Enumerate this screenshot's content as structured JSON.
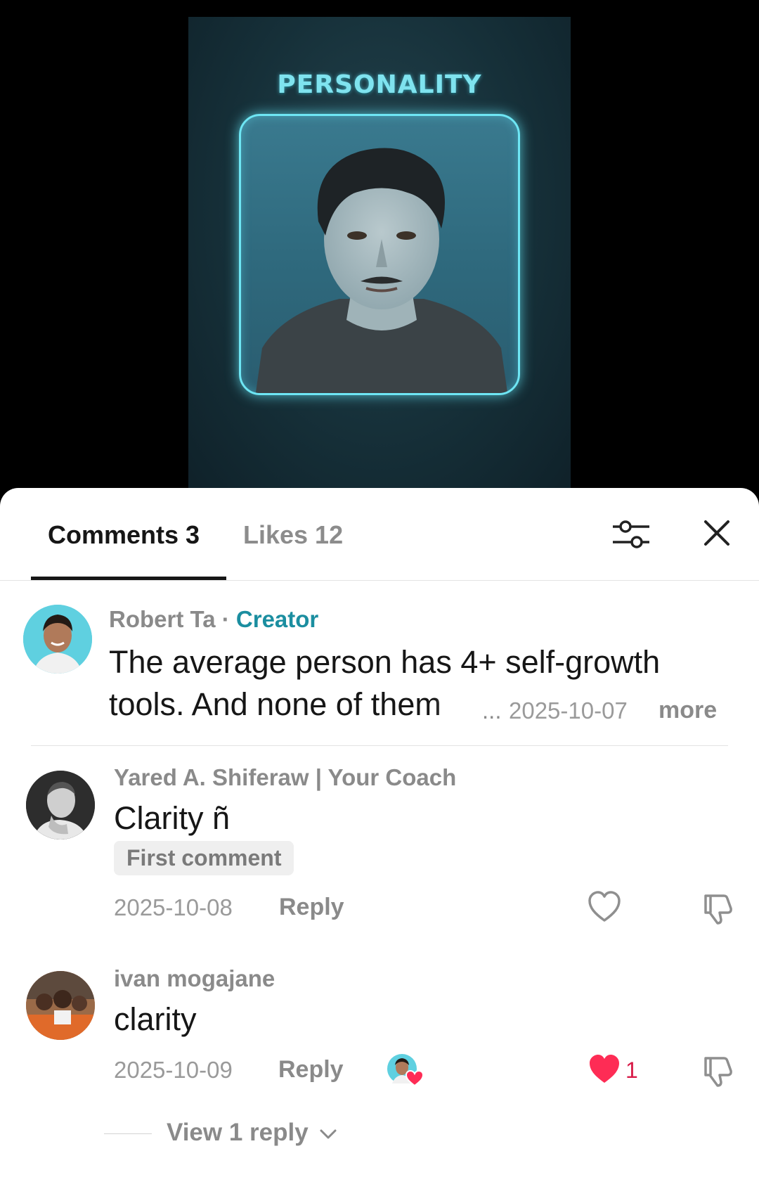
{
  "video": {
    "title": "PERSONALITY"
  },
  "tabs": {
    "comments_label": "Comments 3",
    "likes_label": "Likes 12"
  },
  "icons": {
    "filter": "sliders-icon",
    "close": "close-icon",
    "like": "heart-outline-icon",
    "liked": "heart-filled-icon",
    "dislike": "thumbs-down-icon",
    "creator_liked": "creator-liked-badge-icon",
    "expand": "chevron-down-icon"
  },
  "colors": {
    "accent_creator": "#1b8ea0",
    "like_red": "#fe2c55",
    "text_primary": "#161616",
    "text_secondary": "#8a8a8a"
  },
  "comments": [
    {
      "author": "Robert Ta",
      "separator": " · ",
      "tag": "Creator",
      "text_line1": "The average person has 4+ self-growth",
      "text_line2": "tools. And none of them",
      "ellipsis": "...",
      "date": "2025-10-07",
      "more_label": "more"
    },
    {
      "author": "Yared A. Shiferaw | Your Coach",
      "text": "Clarity ñ",
      "badge": "First comment",
      "date": "2025-10-08",
      "reply_label": "Reply"
    },
    {
      "author": "ivan mogajane",
      "text": "clarity",
      "date": "2025-10-09",
      "reply_label": "Reply",
      "likes": "1",
      "view_replies_label": "View 1 reply"
    }
  ]
}
